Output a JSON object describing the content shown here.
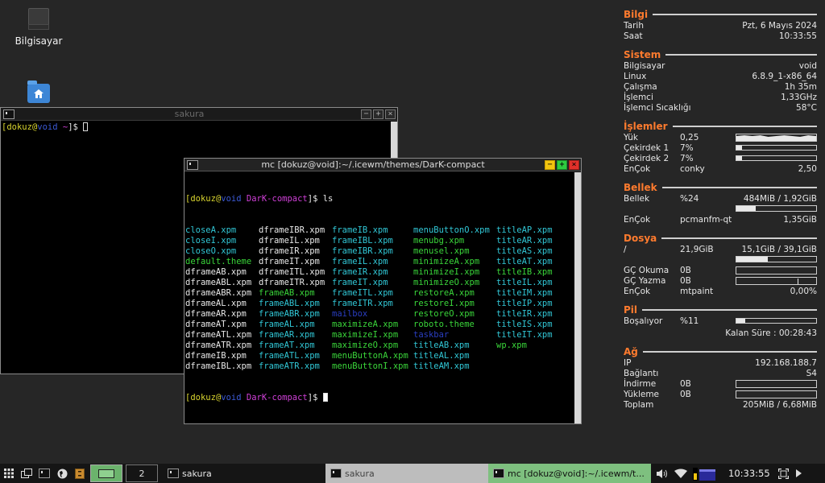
{
  "desktop": {
    "icons": [
      {
        "label": "Bilgisayar",
        "icon": "computer-icon"
      },
      {
        "label": "",
        "icon": "home-folder-icon"
      }
    ]
  },
  "windows": {
    "sakura_back": {
      "title": "sakura",
      "prompt": {
        "user": "dokuz",
        "at": "@",
        "host": "void",
        "path": " ~",
        "tail": "]$ "
      }
    },
    "mc": {
      "title": "mc [dokuz@void]:~/.icewm/themes/DarK-compact",
      "prompt": {
        "user": "dokuz",
        "at": "@",
        "host": "void",
        "path": " DarK-compact",
        "tail": "]$ "
      },
      "command": "ls",
      "files": [
        {
          "name": "closeA.xpm",
          "color": "cyan"
        },
        {
          "name": "dframeIBR.xpm",
          "color": "white"
        },
        {
          "name": "frameIB.xpm",
          "color": "cyan"
        },
        {
          "name": "menuButtonO.xpm",
          "color": "cyan"
        },
        {
          "name": "titleAP.xpm",
          "color": "cyan"
        },
        {
          "name": "closeI.xpm",
          "color": "cyan"
        },
        {
          "name": "dframeIL.xpm",
          "color": "white"
        },
        {
          "name": "frameIBL.xpm",
          "color": "cyan"
        },
        {
          "name": "menubg.xpm",
          "color": "green"
        },
        {
          "name": "titleAR.xpm",
          "color": "cyan"
        },
        {
          "name": "closeO.xpm",
          "color": "cyan"
        },
        {
          "name": "dframeIR.xpm",
          "color": "white"
        },
        {
          "name": "frameIBR.xpm",
          "color": "cyan"
        },
        {
          "name": "menusel.xpm",
          "color": "green"
        },
        {
          "name": "titleAS.xpm",
          "color": "cyan"
        },
        {
          "name": "default.theme",
          "color": "green"
        },
        {
          "name": "dframeIT.xpm",
          "color": "white"
        },
        {
          "name": "frameIL.xpm",
          "color": "cyan"
        },
        {
          "name": "minimizeA.xpm",
          "color": "green"
        },
        {
          "name": "titleAT.xpm",
          "color": "cyan"
        },
        {
          "name": "dframeAB.xpm",
          "color": "white"
        },
        {
          "name": "dframeITL.xpm",
          "color": "white"
        },
        {
          "name": "frameIR.xpm",
          "color": "cyan"
        },
        {
          "name": "minimizeI.xpm",
          "color": "green"
        },
        {
          "name": "titleIB.xpm",
          "color": "green"
        },
        {
          "name": "dframeABL.xpm",
          "color": "white"
        },
        {
          "name": "dframeITR.xpm",
          "color": "white"
        },
        {
          "name": "frameIT.xpm",
          "color": "cyan"
        },
        {
          "name": "minimizeO.xpm",
          "color": "green"
        },
        {
          "name": "titleIL.xpm",
          "color": "cyan"
        },
        {
          "name": "dframeABR.xpm",
          "color": "white"
        },
        {
          "name": "frameAB.xpm",
          "color": "green"
        },
        {
          "name": "frameITL.xpm",
          "color": "cyan"
        },
        {
          "name": "restoreA.xpm",
          "color": "green"
        },
        {
          "name": "titleIM.xpm",
          "color": "cyan"
        },
        {
          "name": "dframeAL.xpm",
          "color": "white"
        },
        {
          "name": "frameABL.xpm",
          "color": "cyan"
        },
        {
          "name": "frameITR.xpm",
          "color": "cyan"
        },
        {
          "name": "restoreI.xpm",
          "color": "green"
        },
        {
          "name": "titleIP.xpm",
          "color": "cyan"
        },
        {
          "name": "dframeAR.xpm",
          "color": "white"
        },
        {
          "name": "frameABR.xpm",
          "color": "cyan"
        },
        {
          "name": "mailbox",
          "color": "blue"
        },
        {
          "name": "restoreO.xpm",
          "color": "green"
        },
        {
          "name": "titleIR.xpm",
          "color": "cyan"
        },
        {
          "name": "dframeAT.xpm",
          "color": "white"
        },
        {
          "name": "frameAL.xpm",
          "color": "cyan"
        },
        {
          "name": "maximizeA.xpm",
          "color": "green"
        },
        {
          "name": "roboto.theme",
          "color": "green"
        },
        {
          "name": "titleIS.xpm",
          "color": "cyan"
        },
        {
          "name": "dframeATL.xpm",
          "color": "white"
        },
        {
          "name": "frameAR.xpm",
          "color": "cyan"
        },
        {
          "name": "maximizeI.xpm",
          "color": "green"
        },
        {
          "name": "taskbar",
          "color": "blue"
        },
        {
          "name": "titleIT.xpm",
          "color": "cyan"
        },
        {
          "name": "dframeATR.xpm",
          "color": "white"
        },
        {
          "name": "frameAT.xpm",
          "color": "cyan"
        },
        {
          "name": "maximizeO.xpm",
          "color": "green"
        },
        {
          "name": "titleAB.xpm",
          "color": "cyan"
        },
        {
          "name": "wp.xpm",
          "color": "green"
        },
        {
          "name": "dframeIB.xpm",
          "color": "white"
        },
        {
          "name": "frameATL.xpm",
          "color": "cyan"
        },
        {
          "name": "menuButtonA.xpm",
          "color": "green"
        },
        {
          "name": "titleAL.xpm",
          "color": "cyan"
        },
        {
          "name": "",
          "color": "white"
        },
        {
          "name": "dframeIBL.xpm",
          "color": "white"
        },
        {
          "name": "frameATR.xpm",
          "color": "cyan"
        },
        {
          "name": "menuButtonI.xpm",
          "color": "green"
        },
        {
          "name": "titleAM.xpm",
          "color": "cyan"
        },
        {
          "name": "",
          "color": "white"
        }
      ]
    }
  },
  "conky": {
    "bilgi": {
      "title": "Bilgi",
      "tarih_label": "Tarih",
      "tarih_value": "Pzt, 6 Mayıs 2024",
      "saat_label": "Saat",
      "saat_value": "10:33:55"
    },
    "sistem": {
      "title": "Sistem",
      "rows": [
        {
          "label": "Bilgisayar",
          "value": "void"
        },
        {
          "label": "Linux",
          "value": "6.8.9_1-x86_64"
        },
        {
          "label": "Çalışma",
          "value": "1h 35m"
        },
        {
          "label": "İşlemci",
          "value": "1,33GHz"
        },
        {
          "label": "İşlemci Sıcaklığı",
          "value": "58°C"
        }
      ]
    },
    "islemler": {
      "title": "İşlemler",
      "yuk_label": "Yük",
      "yuk_value": "0,25",
      "cores": [
        {
          "label": "Çekirdek 1",
          "value": "7%",
          "level": 0.07
        },
        {
          "label": "Çekirdek 2",
          "value": "7%",
          "level": 0.07
        }
      ],
      "encok_label": "EnÇok",
      "encok_name": "conky",
      "encok_value": "2,50"
    },
    "bellek": {
      "title": "Bellek",
      "label": "Bellek",
      "percent": "%24",
      "value": "484MiB / 1,92GiB",
      "level": 0.24,
      "encok_label": "EnÇok",
      "encok_name": "pcmanfm-qt",
      "encok_value": "1,35GiB"
    },
    "dosya": {
      "title": "Dosya",
      "root_label": "/",
      "root_used": "21,9GiB",
      "root_value": "15,1GiB / 39,1GiB",
      "level": 0.39,
      "okuma_label": "GÇ Okuma",
      "okuma_value": "0B",
      "yazma_label": "GÇ Yazma",
      "yazma_value": "0B",
      "encok_label": "EnÇok",
      "encok_name": "mtpaint",
      "encok_value": "0,00%"
    },
    "pil": {
      "title": "Pil",
      "label": "Boşalıyor",
      "percent": "%11",
      "level": 0.11,
      "kalan": "Kalan Süre : 00:28:43"
    },
    "ag": {
      "title": "Ağ",
      "ip_label": "IP",
      "ip_value": "192.168.188.7",
      "baglanti_label": "Bağlantı",
      "baglanti_value": "S4",
      "indirme_label": "İndirme",
      "indirme_value": "0B",
      "yukleme_label": "Yükleme",
      "yukleme_value": "0B",
      "toplam_label": "Toplam",
      "toplam_value": "205MiB / 6,68MiB"
    }
  },
  "taskbar": {
    "workspace_number": "2",
    "tasks": [
      {
        "label": "sakura"
      },
      {
        "label": "sakura"
      },
      {
        "label": "mc [dokuz@void]:~/.icewm/t..."
      }
    ],
    "clock": "10:33:55",
    "colors": {
      "active_task": "#7ec07f",
      "inactive_task": "#bdbdbd",
      "workspace": "#6bb36c"
    }
  },
  "colors": {
    "conky_heading": "#ff7b2e",
    "desktop_bg": "#262626"
  }
}
